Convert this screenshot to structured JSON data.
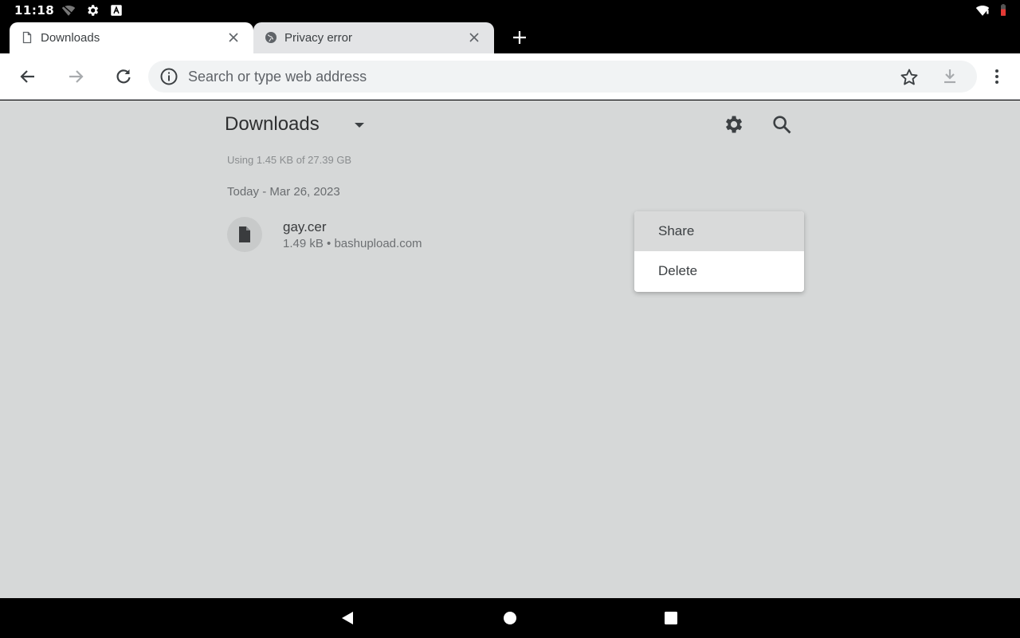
{
  "status_bar": {
    "time": "11:18",
    "icons": [
      "wifi-off-icon",
      "settings-gear-icon",
      "keyboard-icon",
      "wifi-icon",
      "battery-icon"
    ]
  },
  "tabs": [
    {
      "title": "Downloads",
      "icon": "page-icon",
      "active": true
    },
    {
      "title": "Privacy error",
      "icon": "globe-icon",
      "active": false
    }
  ],
  "toolbar": {
    "omnibox_placeholder": "Search or type web address"
  },
  "downloads": {
    "title": "Downloads",
    "storage": "Using 1.45 KB of 27.39 GB",
    "date_header": "Today - Mar 26, 2023",
    "items": [
      {
        "name": "gay.cer",
        "meta": "1.49 kB • bashupload.com",
        "icon": "file-icon"
      }
    ]
  },
  "context_menu": {
    "items": [
      {
        "label": "Share"
      },
      {
        "label": "Delete"
      }
    ]
  },
  "colors": {
    "scrim": "#d6d8d8",
    "menu_highlight": "#d9dada",
    "omnibox_bg": "#f1f3f4"
  }
}
